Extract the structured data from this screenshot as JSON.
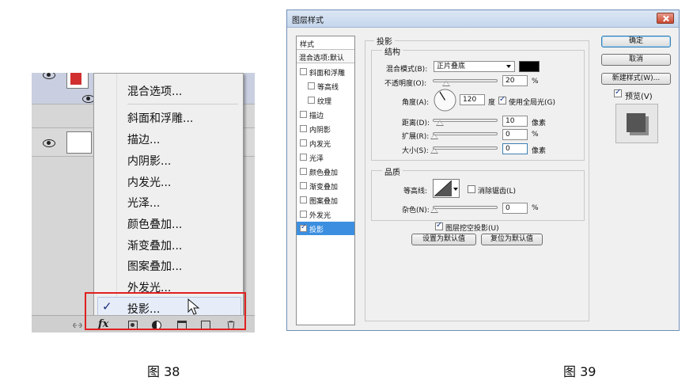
{
  "figure38": {
    "caption": "图 38",
    "menu_items": [
      "混合选项...",
      "斜面和浮雕...",
      "描边...",
      "内阴影...",
      "内发光...",
      "光泽...",
      "颜色叠加...",
      "渐变叠加...",
      "图案叠加...",
      "外发光...",
      "投影..."
    ],
    "checked_item_index": 10,
    "check_glyph": "✓",
    "fx_label": "fx",
    "highlight_color": "#e02020"
  },
  "figure39": {
    "caption": "图 39",
    "dialog_title": "图层样式",
    "style_list": {
      "header": "样式",
      "blend_options": "混合选项:默认",
      "items": [
        {
          "label": "斜面和浮雕",
          "checked": false
        },
        {
          "label": "等高线",
          "checked": false
        },
        {
          "label": "纹理",
          "checked": false
        },
        {
          "label": "描边",
          "checked": false
        },
        {
          "label": "内阴影",
          "checked": false
        },
        {
          "label": "内发光",
          "checked": false
        },
        {
          "label": "光泽",
          "checked": false
        },
        {
          "label": "颜色叠加",
          "checked": false
        },
        {
          "label": "渐变叠加",
          "checked": false
        },
        {
          "label": "图案叠加",
          "checked": false
        },
        {
          "label": "外发光",
          "checked": false
        },
        {
          "label": "投影",
          "checked": true,
          "selected": true
        }
      ]
    },
    "drop_shadow": {
      "group_title": "投影",
      "structure_title": "结构",
      "blend_mode_label": "混合模式(B):",
      "blend_mode_value": "正片叠底",
      "shadow_color": "#000000",
      "opacity_label": "不透明度(O):",
      "opacity_value": "20",
      "opacity_unit": "%",
      "angle_label": "角度(A):",
      "angle_value": "120",
      "angle_unit": "度",
      "global_light_label": "使用全局光(G)",
      "global_light_checked": true,
      "distance_label": "距离(D):",
      "distance_value": "10",
      "distance_unit": "像素",
      "spread_label": "扩展(R):",
      "spread_value": "0",
      "spread_unit": "%",
      "size_label": "大小(S):",
      "size_value": "0",
      "size_unit": "像素",
      "quality_title": "品质",
      "contour_label": "等高线:",
      "antialias_label": "消除锯齿(L)",
      "noise_label": "杂色(N):",
      "noise_value": "0",
      "noise_unit": "%",
      "knockout_label": "图层挖空投影(U)",
      "knockout_checked": true,
      "make_default_label": "设置为默认值",
      "reset_default_label": "复位为默认值"
    },
    "buttons": {
      "ok": "确定",
      "cancel": "取消",
      "new_style": "新建样式(W)...",
      "preview_label": "预览(V)",
      "preview_checked": true
    }
  }
}
